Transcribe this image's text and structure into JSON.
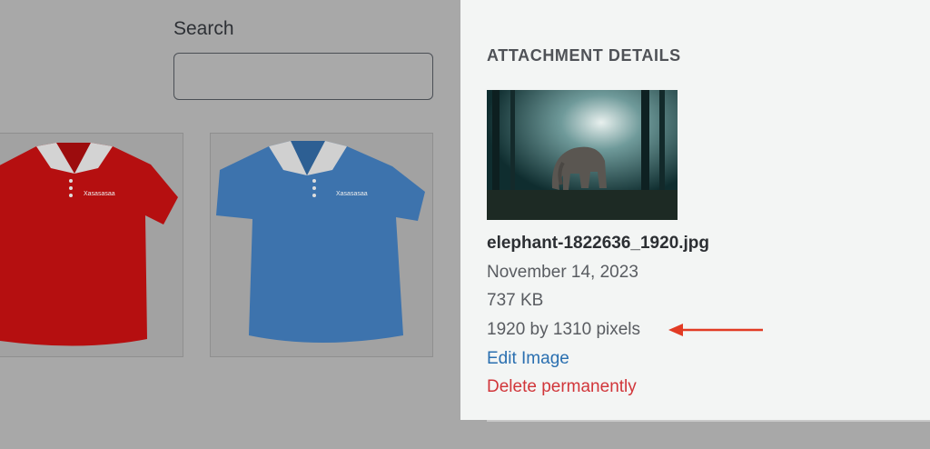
{
  "library": {
    "search_label": "Search",
    "search_value": "",
    "items": [
      {
        "name": "red-polo-shirt",
        "color": "#b31313"
      },
      {
        "name": "blue-polo-shirt",
        "color": "#3f74ae"
      }
    ]
  },
  "attachment": {
    "title": "ATTACHMENT DETAILS",
    "filename": "elephant-1822636_1920.jpg",
    "date": "November 14, 2023",
    "size": "737 KB",
    "dimensions": "1920 by 1310 pixels",
    "edit_label": "Edit Image",
    "delete_label": "Delete permanently"
  },
  "annotation": {
    "arrow_color": "#e23b24"
  },
  "colors": {
    "link": "#2a6fb0",
    "danger": "#d1363a"
  }
}
